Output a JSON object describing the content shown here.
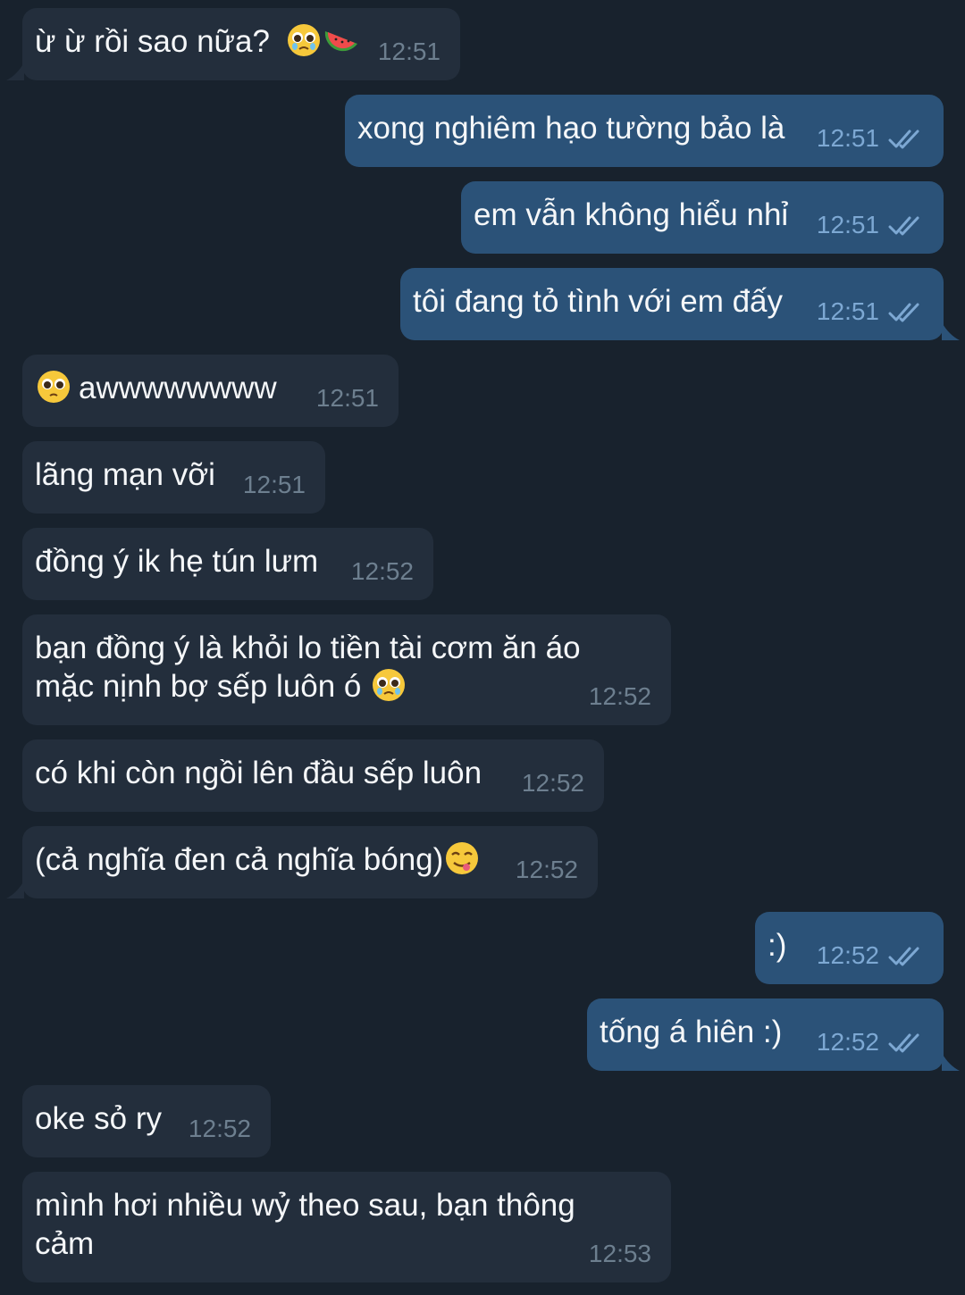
{
  "messages": [
    {
      "dir": "in",
      "text": "ừ ừ rồi sao nữa?",
      "emojis": [
        "pleading-teary-emoji",
        "watermelon-emoji"
      ],
      "time": "12:51"
    },
    {
      "dir": "out",
      "text": "xong nghiêm hạo tường bảo là",
      "time": "12:51",
      "status": "read"
    },
    {
      "dir": "out",
      "text": "em vẫn không hiểu nhỉ",
      "time": "12:51",
      "status": "read"
    },
    {
      "dir": "out",
      "text": "tôi đang tỏ tình với em đấy",
      "time": "12:51",
      "status": "read"
    },
    {
      "dir": "in",
      "text": "awwwwwwww",
      "emoji_before": "pleading-face-emoji",
      "time": "12:51"
    },
    {
      "dir": "in",
      "text": "lãng mạn vỡi",
      "time": "12:51"
    },
    {
      "dir": "in",
      "text": "đồng ý ik hẹ tún lưm",
      "time": "12:52"
    },
    {
      "dir": "in",
      "text": "bạn đồng ý là khỏi lo tiền tài cơm ăn áo mặc nịnh bợ sếp luôn ó",
      "emojis": [
        "pleading-teary-emoji"
      ],
      "time": "12:52"
    },
    {
      "dir": "in",
      "text": "có khi còn ngồi lên đầu sếp luôn",
      "time": "12:52"
    },
    {
      "dir": "in",
      "text": "(cả nghĩa đen cả nghĩa bóng)",
      "emojis": [
        "yum-face-emoji"
      ],
      "time": "12:52"
    },
    {
      "dir": "out",
      "text": ":)",
      "time": "12:52",
      "status": "read"
    },
    {
      "dir": "out",
      "text": "tống á hiên :)",
      "time": "12:52",
      "status": "read"
    },
    {
      "dir": "in",
      "text": "oke sỏ ry",
      "time": "12:52"
    },
    {
      "dir": "in",
      "text": "mình hơi nhiều wỷ theo sau, bạn thông cảm",
      "time": "12:53"
    }
  ],
  "colors": {
    "background": "#18222d",
    "incoming_bubble": "#232e3c",
    "outgoing_bubble": "#2b5278",
    "text": "#f5f7f9",
    "incoming_time": "#6d7f8f",
    "outgoing_time": "#7da8d3"
  }
}
